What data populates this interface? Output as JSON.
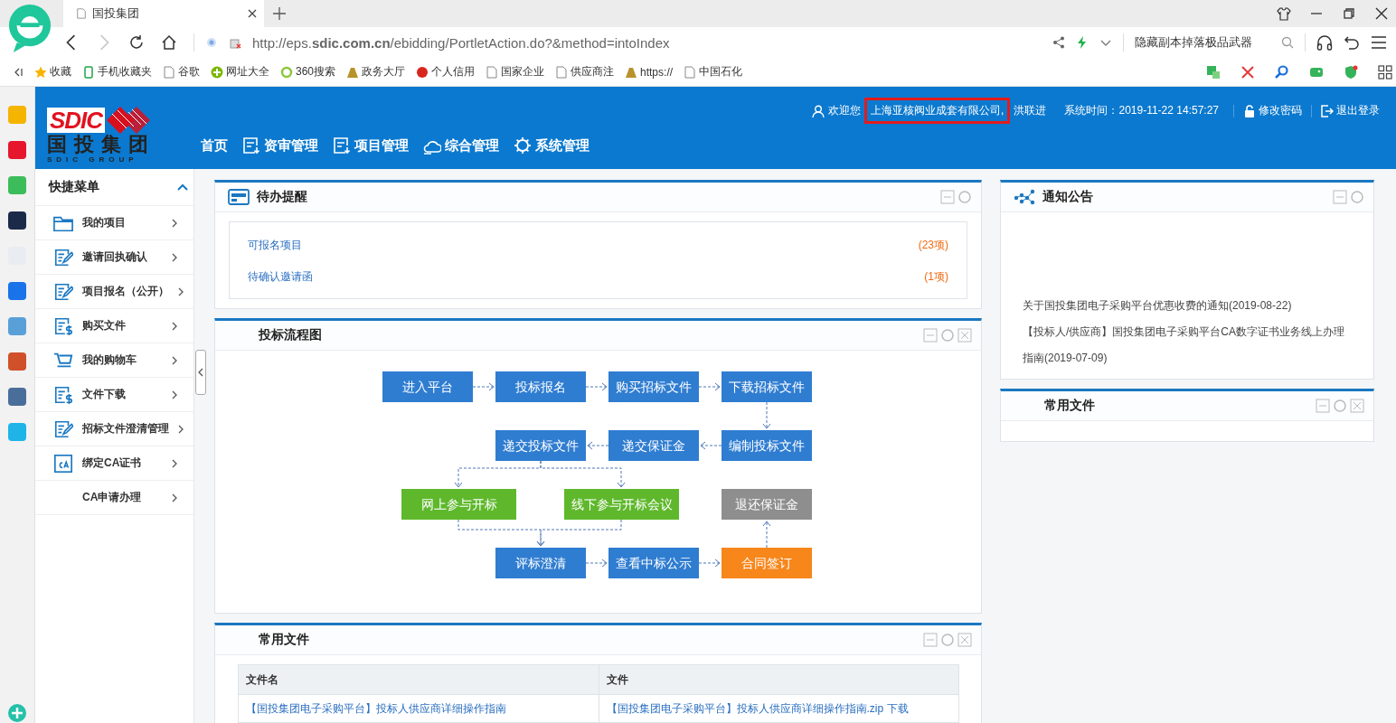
{
  "browser": {
    "tab": {
      "title": "国投集团"
    },
    "forward_disabled": true,
    "url": "http://eps.**sdic.com.cn**/ebidding/PortletAction.do?&method=intoIndex",
    "search": {
      "value": "隐藏副本掉落极品武器"
    },
    "bookmarks": [
      {
        "label": "收藏",
        "kind": "star"
      },
      {
        "label": "手机收藏夹",
        "kind": "phone"
      },
      {
        "label": "谷歌",
        "kind": "page"
      },
      {
        "label": "网址大全",
        "kind": "globe"
      },
      {
        "label": "360搜索",
        "kind": "ring"
      },
      {
        "label": "政务大厅",
        "kind": "mound"
      },
      {
        "label": "个人信用",
        "kind": "emblem"
      },
      {
        "label": "国家企业",
        "kind": "page"
      },
      {
        "label": "供应商注",
        "kind": "page"
      },
      {
        "label": "https://",
        "kind": "mound"
      },
      {
        "label": "中国石化",
        "kind": "page"
      }
    ]
  },
  "header": {
    "logo": {
      "mark": "SDIC",
      "name": "国投集团",
      "sub": "SDIC GROUP"
    },
    "nav": [
      {
        "label": "首页",
        "kind": "text"
      },
      {
        "label": "资审管理",
        "kind": "doc"
      },
      {
        "label": "项目管理",
        "kind": "doc"
      },
      {
        "label": "综合管理",
        "kind": "cloud"
      },
      {
        "label": "系统管理",
        "kind": "gear"
      }
    ],
    "welcome": "欢迎您",
    "company": {
      "name": "上海亚核阀业成套有限公司,",
      "highlighted": true
    },
    "user": "洪联进",
    "time": "系统时间：2019-11-22 14:57:27",
    "actions": [
      {
        "label": "修改密码",
        "kind": "lock"
      },
      {
        "label": "退出登录",
        "kind": "exit"
      }
    ]
  },
  "sidebar": {
    "title": "快捷菜单",
    "expanded": true,
    "items": [
      {
        "label": "我的项目",
        "kind": "folder"
      },
      {
        "label": "邀请回执确认",
        "kind": "edit"
      },
      {
        "label": "项目报名（公开）",
        "kind": "edit"
      },
      {
        "label": "购买文件",
        "kind": "bill"
      },
      {
        "label": "我的购物车",
        "kind": "cart"
      },
      {
        "label": "文件下载",
        "kind": "bill"
      },
      {
        "label": "招标文件澄清管理",
        "kind": "edit"
      },
      {
        "label": "绑定CA证书",
        "kind": "ca"
      },
      {
        "label": "CA申请办理",
        "kind": "none"
      }
    ]
  },
  "pending": {
    "title": "待办提醒",
    "closable": false,
    "items": [
      {
        "label": "可报名项目",
        "count": "(23项)"
      },
      {
        "label": "待确认邀请函",
        "count": "(1项)"
      }
    ]
  },
  "flow": {
    "title": "投标流程图",
    "closable": true,
    "nodes": [
      {
        "label": "进入平台",
        "color": "#2f7dd1"
      },
      {
        "label": "投标报名",
        "color": "#2f7dd1"
      },
      {
        "label": "购买招标文件",
        "color": "#2f7dd1"
      },
      {
        "label": "下载招标文件",
        "color": "#2f7dd1"
      },
      {
        "label": "递交投标文件",
        "color": "#2f7dd1"
      },
      {
        "label": "递交保证金",
        "color": "#2f7dd1"
      },
      {
        "label": "编制投标文件",
        "color": "#2f7dd1"
      },
      {
        "label": "网上参与开标",
        "color": "#5fb82c"
      },
      {
        "label": "线下参与开标会议",
        "color": "#5fb82c"
      },
      {
        "label": "退还保证金",
        "color": "#8e8e8e"
      },
      {
        "label": "评标澄清",
        "color": "#2f7dd1"
      },
      {
        "label": "查看中标公示",
        "color": "#2f7dd1"
      },
      {
        "label": "合同签订",
        "color": "#f7861b"
      }
    ]
  },
  "files": {
    "title": "常用文件",
    "closable": true,
    "columns": [
      "文件名",
      "文件"
    ],
    "rows": [
      {
        "name": "【国投集团电子采购平台】投标人供应商详细操作指南",
        "file": "【国投集团电子采购平台】投标人供应商详细操作指南.zip",
        "action": "下载"
      }
    ]
  },
  "notices": {
    "title": "通知公告",
    "closable": false,
    "items": [
      "关于国投集团电子采购平台优惠收费的通知(2019-08-22)",
      "【投标人/供应商】国投集团电子采购平台CA数字证书业务线上办理指南(2019-07-09)"
    ]
  },
  "side_files": {
    "title": "常用文件",
    "closable": true
  }
}
